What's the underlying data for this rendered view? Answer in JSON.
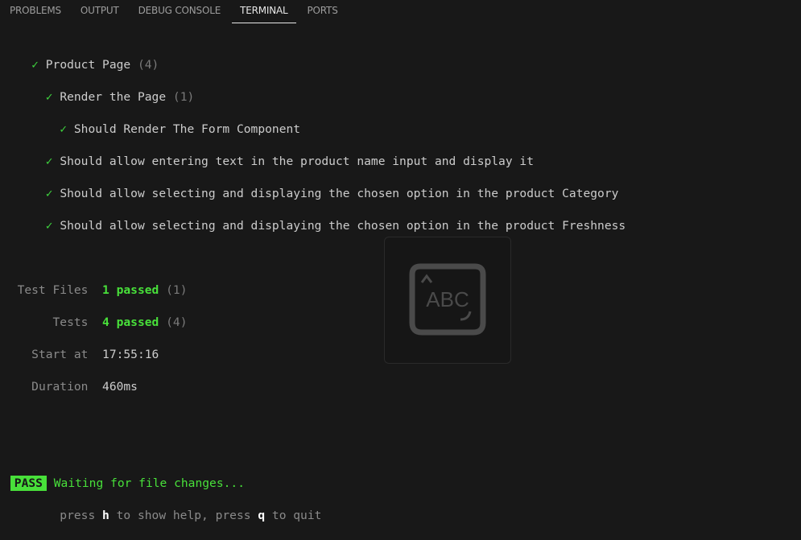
{
  "tabs": [
    {
      "label": "PROBLEMS",
      "active": false
    },
    {
      "label": "OUTPUT",
      "active": false
    },
    {
      "label": "DEBUG CONSOLE",
      "active": false
    },
    {
      "label": "TERMINAL",
      "active": true
    },
    {
      "label": "PORTS",
      "active": false
    }
  ],
  "terminal": {
    "check": "✓",
    "suite": {
      "name": "Product Page",
      "count": "(4)"
    },
    "group": {
      "name": "Render the Page",
      "count": "(1)"
    },
    "tests": [
      "Should Render The Form Component",
      "Should allow entering text in the product name input and display it",
      "Should allow selecting and displaying the chosen option in the product Category",
      "Should allow selecting and displaying the chosen option in the product Freshness"
    ],
    "summary": {
      "test_files_label": "Test Files",
      "test_files_value": "1 passed",
      "test_files_total": "(1)",
      "tests_label": "Tests",
      "tests_value": "4 passed",
      "tests_total": "(4)",
      "start_label": "Start at",
      "start_value": "17:55:16",
      "duration_label": "Duration",
      "duration_value": "460ms"
    },
    "status_badge": "PASS",
    "waiting": "Waiting for file changes...",
    "hint": {
      "p1": "press ",
      "k1": "h",
      "p2": " to show help, press ",
      "k2": "q",
      "p3": " to quit"
    }
  },
  "overlay": {
    "text": "ABC"
  },
  "colors": {
    "accent_green": "#48e03a",
    "background": "#181818"
  }
}
